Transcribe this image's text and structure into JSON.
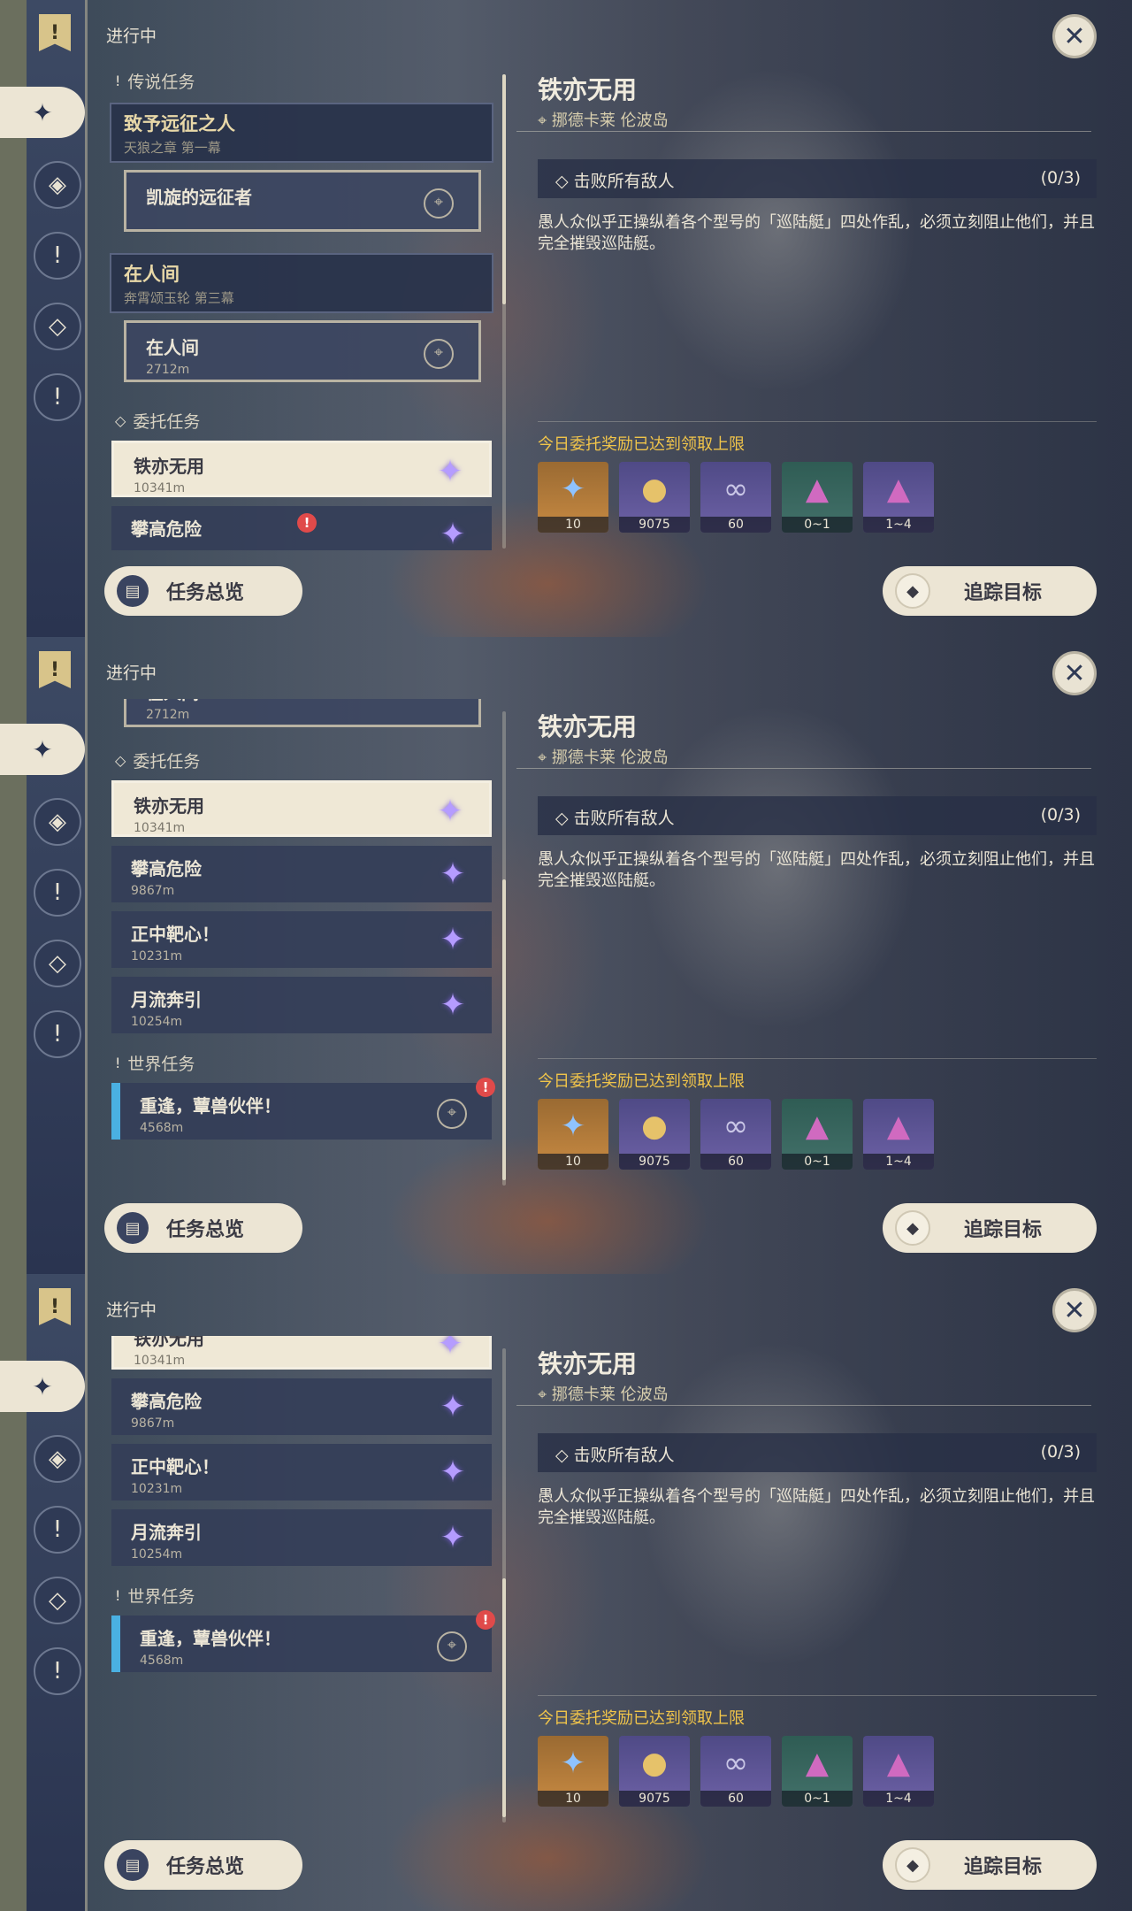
{
  "status_label": "进行中",
  "close_label": "✕",
  "sections": {
    "legend": "传说任务",
    "commission": "委托任务",
    "world": "世界任务"
  },
  "legend_groups": [
    {
      "title": "致予远征之人",
      "subtitle": "天狼之章 第一幕",
      "sub_title": "凯旋的远征者"
    },
    {
      "title": "在人间",
      "subtitle": "奔霄颂玉轮 第三幕",
      "sub_title": "在人间",
      "sub_distance": "2712m"
    }
  ],
  "commissions": [
    {
      "title": "铁亦无用",
      "distance": "10341m"
    },
    {
      "title": "攀高危险",
      "distance": "9867m"
    },
    {
      "title": "正中靶心！",
      "distance": "10231m"
    },
    {
      "title": "月流奔引",
      "distance": "10254m"
    }
  ],
  "world_quests": [
    {
      "title": "重逢，蕈兽伙伴！",
      "distance": "4568m"
    }
  ],
  "detail": {
    "title": "铁亦无用",
    "location": "挪德卡莱 伦波岛",
    "objective": "击败所有敌人",
    "objective_count": "(0/3)",
    "description": "愚人众似乎正操纵着各个型号的「巡陆艇」四处作乱，必须立刻阻止他们，并且完全摧毁巡陆艇。",
    "reward_limit": "今日委托奖励已达到领取上限",
    "rewards": [
      {
        "icon": "adventure-exp-icon",
        "count": "10"
      },
      {
        "icon": "mora-icon",
        "count": "9075"
      },
      {
        "icon": "companionship-exp-icon",
        "count": "60"
      },
      {
        "icon": "crystal-icon",
        "count": "0~1"
      },
      {
        "icon": "crystal-cluster-icon",
        "count": "1~4"
      }
    ]
  },
  "buttons": {
    "overview": "任务总览",
    "track": "追踪目标"
  },
  "colors": {
    "accent_cream": "#ece5d4",
    "panel_navy": "#2f3a55",
    "reward_limit_yellow": "#f0c44a",
    "world_quest_blue": "#4ab0e2"
  }
}
